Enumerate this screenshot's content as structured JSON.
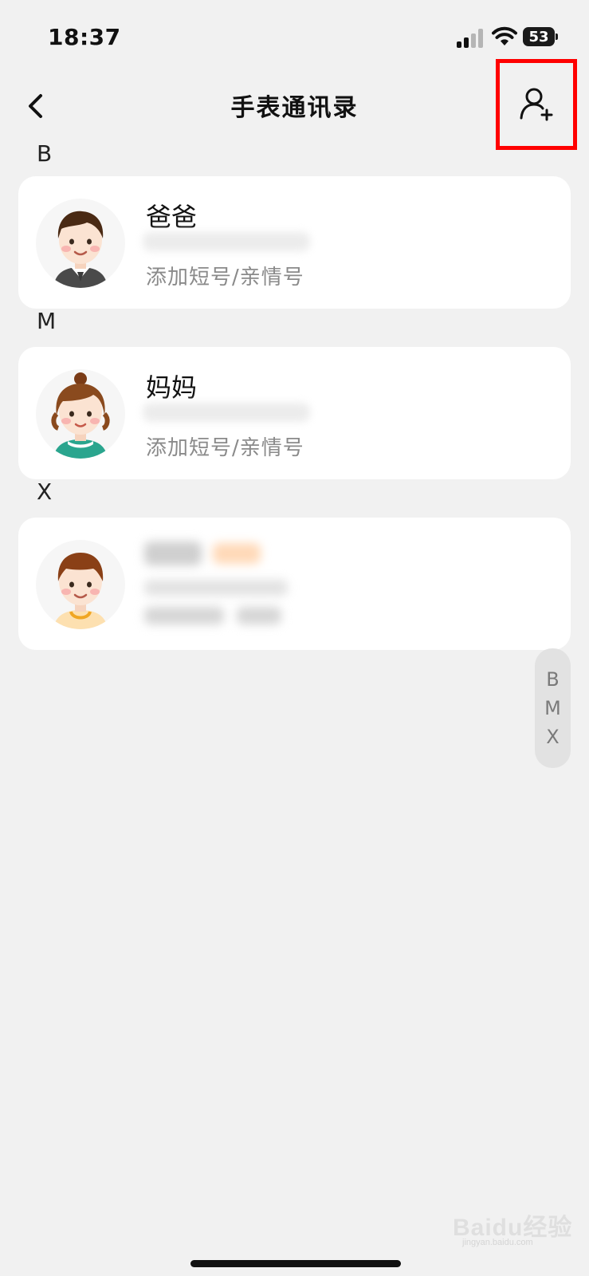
{
  "status_bar": {
    "time": "18:37",
    "battery": "53"
  },
  "header": {
    "title": "手表通讯录",
    "back_icon": "chevron-left-icon",
    "add_icon": "add-user-icon",
    "highlight_color": "#ff0000"
  },
  "sections": [
    {
      "letter": "B",
      "contact": {
        "name": "爸爸",
        "action": "添加短号/亲情号",
        "avatar": "dad-avatar"
      }
    },
    {
      "letter": "M",
      "contact": {
        "name": "妈妈",
        "action": "添加短号/亲情号",
        "avatar": "mom-avatar"
      }
    },
    {
      "letter": "X",
      "contact": {
        "avatar": "child-avatar"
      }
    }
  ],
  "index_bar": [
    "B",
    "M",
    "X"
  ],
  "watermark": {
    "text": "Baidu经验",
    "sub": "jingyan.baidu.com"
  }
}
